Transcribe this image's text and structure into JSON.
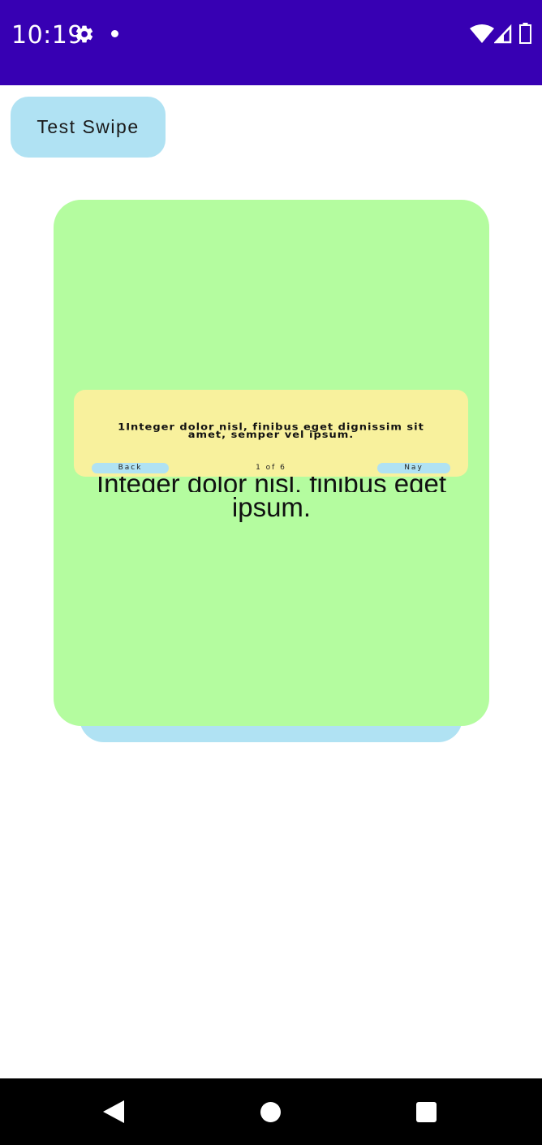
{
  "status_bar": {
    "time": "10:19",
    "icons": [
      "gear-icon",
      "notification-dot-icon",
      "wifi-icon",
      "signal-icon",
      "battery-icon"
    ],
    "background": "#3700b3"
  },
  "test_swipe_button": {
    "label": "Test Swipe",
    "color": "#b0e2f3"
  },
  "card": {
    "background": "#b4fc9f",
    "text_partial": "Integer dolor nisl, finibus eget",
    "text_visible": "ipsum."
  },
  "overlay_card": {
    "background": "#f8f19d",
    "text": "1Integer dolor nisl, finibus eget dignissim sit amet, semper vel ipsum.",
    "back_label": "Back",
    "counter": "1 of 6",
    "next_label": "Nay"
  },
  "nav_bar": {
    "icons": [
      "back-icon",
      "home-icon",
      "recents-icon"
    ]
  }
}
